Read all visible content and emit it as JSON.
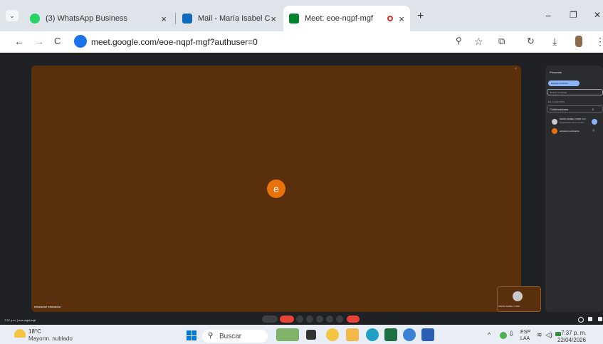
{
  "browser": {
    "tabs": [
      {
        "title": "(3) WhatsApp Business",
        "close": "×"
      },
      {
        "title": "Mail - María Isabel Cobo - Outlook",
        "close": "×"
      },
      {
        "title": "Meet: eoe-nqpf-mgf",
        "close": "×"
      }
    ],
    "new_tab": "+",
    "window_controls": {
      "minimize": "−",
      "restore": "❐",
      "close": "✕"
    },
    "nav": {
      "back": "←",
      "forward": "→",
      "reload": "C"
    },
    "url": "meet.google.com/eoe-nqpf-mgf?authuser=0",
    "toolbar_icons": [
      "zoom-icon",
      "star-icon",
      "extensions-icon",
      "history-icon",
      "download-icon",
      "profile-icon",
      "menu-icon"
    ]
  },
  "meet": {
    "main_avatar_letter": "e",
    "main_participant": "educacion educacion",
    "self_participant": "MARÍA ISABEL COBO",
    "meeting_time": "7:37 p.m.",
    "meeting_code": "eoe-nqpf-mgf",
    "panel": {
      "title": "Personas",
      "add_people": "Agregar personas",
      "search_placeholder": "Buscar contactos",
      "section": "EN LA REUNIÓN",
      "group_label": "Colaboradores",
      "group_count": "2",
      "participants": [
        {
          "name": "MARÍA ISABEL COBO (Tú)",
          "role": "Organizador de la reunión"
        },
        {
          "name": "educacion educacion",
          "role": ""
        }
      ]
    }
  },
  "taskbar": {
    "temperature": "18°C",
    "weather": "Mayorm. nublado",
    "search_label": "Buscar",
    "lang_line1": "ESP",
    "lang_line2": "LAA",
    "time": "7:37 p. m.",
    "date": "22/04/2026"
  },
  "colors": {
    "tile": "#5a2f0c",
    "avatar": "#e8710a",
    "end_call": "#ea4335",
    "accent": "#8ab4f8"
  }
}
